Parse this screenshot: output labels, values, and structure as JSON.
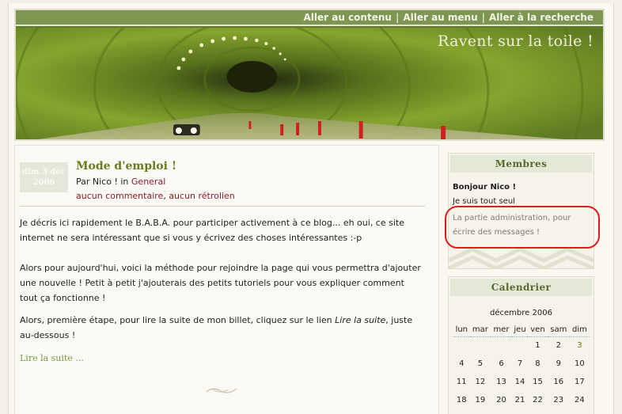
{
  "nav": {
    "links": [
      "Aller au contenu",
      "Aller au menu",
      "Aller à la recherche"
    ],
    "separator": "|"
  },
  "site_title": "Ravent sur la toile !",
  "post": {
    "date_line1": "dim 3 dec",
    "date_line2": "2006",
    "title": "Mode d'emploi !",
    "by_prefix": "Par Nico ! in",
    "category": "General",
    "comments": "aucun commentaire",
    "link_sep": ",",
    "trackbacks": "aucun rétrolien",
    "p1": "Je décris ici rapidement le B.A.B.A. pour participer activement à ce blog... eh oui, ce site internet ne sera intéressant que si vous y écrivez des choses intéressantes :-p",
    "p2": "Alors pour aujourd'hui, voici la méthode pour rejoindre la page qui vous permettra d'ajouter une nouvelle ! Petit à petit j'ajouterais des petits tutoriels pour vous expliquer comment tout ça fonctionne !",
    "p3_before": "Alors, première étape, pour lire la suite de mon billet, cliquez sur le lien",
    "p3_link": "Lire la suite",
    "p3_after": ", juste au-dessous !",
    "read_more": "Lire la suite ..."
  },
  "members": {
    "heading": "Membres",
    "greeting": "Bonjour Nico !",
    "alone": "Je suis tout seul",
    "admin_link": "La partie administration, pour écrire des messages !"
  },
  "calendar": {
    "heading": "Calendrier",
    "month": "décembre 2006",
    "days": [
      "lun",
      "mar",
      "mer",
      "jeu",
      "ven",
      "sam",
      "dim"
    ],
    "weeks": [
      [
        "",
        "",
        "",
        "",
        "1",
        "2",
        "3"
      ],
      [
        "4",
        "5",
        "6",
        "7",
        "8",
        "9",
        "10"
      ],
      [
        "11",
        "12",
        "13",
        "14",
        "15",
        "16",
        "17"
      ],
      [
        "18",
        "19",
        "20",
        "21",
        "22",
        "23",
        "24"
      ]
    ],
    "today": "3"
  },
  "colors": {
    "header_green": "#7d9651",
    "title_olive": "#6b7b1e",
    "link_red": "#8a1c2c",
    "highlight_red": "#e21a1a"
  }
}
